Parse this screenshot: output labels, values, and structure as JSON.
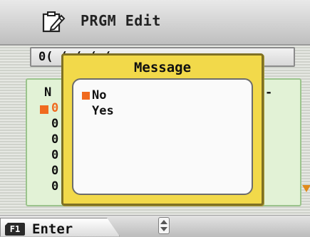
{
  "header": {
    "title": "PRGM Edit",
    "icon": "edit-program-icon"
  },
  "background": {
    "field_text": "0(  (   (  ( ( ",
    "marker_color": "#f06a1e",
    "panel_lines": [
      "N",
      "0",
      "0",
      "0",
      "0",
      "0",
      "0"
    ],
    "panel_right_mark": "-"
  },
  "dialog": {
    "title": "Message",
    "options": [
      "No",
      "Yes"
    ],
    "selected_index": 0,
    "marker_color": "#f06a1e",
    "frame_color": "#f2d94a"
  },
  "footer": {
    "f1_badge": "F1",
    "f1_label": "Enter",
    "scroll_icon": "up-down-scroll-icon"
  }
}
